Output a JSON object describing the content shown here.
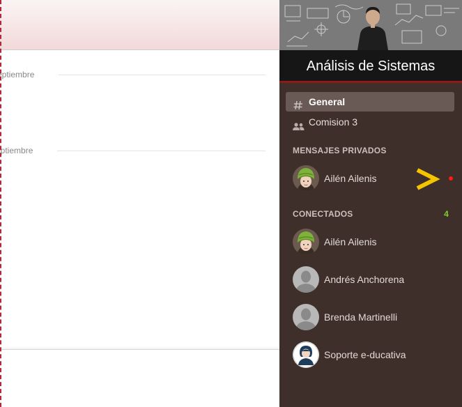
{
  "chat": {
    "date_separators": [
      {
        "label": "eptiembre"
      },
      {
        "label": "eptiembre"
      }
    ]
  },
  "sidebar": {
    "class_title": "Análisis de Sistemas",
    "channels": [
      {
        "label": "General",
        "icon": "hash-icon",
        "active": true
      },
      {
        "label": "Comision 3",
        "icon": "group-icon",
        "active": false
      }
    ],
    "private_messages": {
      "title": "MENSAJES PRIVADOS",
      "items": [
        {
          "name": "Ailén Ailenis",
          "avatar": "green-beanie-avatar",
          "unread": true
        }
      ]
    },
    "connected": {
      "title": "CONECTADOS",
      "count": "4",
      "items": [
        {
          "name": "Ailén Ailenis",
          "avatar": "green-beanie-avatar"
        },
        {
          "name": "Andrés Anchorena",
          "avatar": "default-avatar"
        },
        {
          "name": "Brenda Martinelli",
          "avatar": "default-avatar"
        },
        {
          "name": "Soporte e-ducativa",
          "avatar": "admin-avatar"
        }
      ]
    }
  },
  "colors": {
    "sidebar_bg": "#3f2f2b",
    "title_bar_bg": "#161616",
    "title_underline": "#8e1a1a",
    "active_channel_bg": "#6a5a56",
    "connected_count": "#7ed321",
    "unread_dot": "#ff1a1a",
    "annotation_arrow": "#f5c400",
    "dashed_edge": "#b3283b"
  }
}
